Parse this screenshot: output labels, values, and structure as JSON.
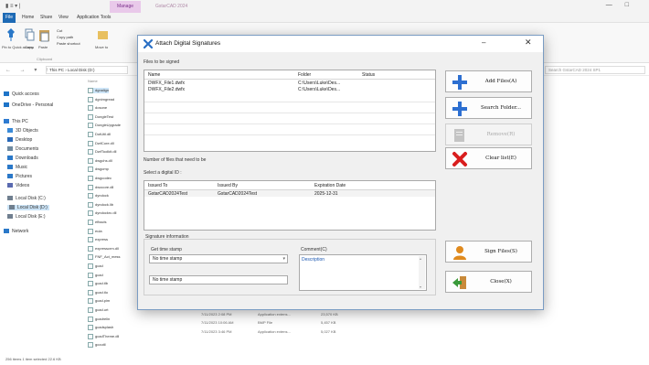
{
  "explorer": {
    "qat": "▮ ≡ ▾ |",
    "context_tab": "Manage",
    "window_title": "GstarCAD 2024",
    "ribbon_tabs": [
      "Home",
      "Share",
      "View",
      "Application Tools"
    ],
    "file_tab": "File",
    "ribbon": {
      "pin_label": "Pin to Quick access",
      "copy_label": "Copy",
      "paste_label": "Paste",
      "cut_label": "Cut",
      "copy_path_label": "Copy path",
      "paste_shortcut_label": "Paste shortcut",
      "move_label": "Move to",
      "clipboard_group": "Clipboard"
    },
    "address": {
      "nav": "← → ▾ ↑",
      "path": "This PC › Local Disk (D:)",
      "search": "Search GstarCAD 2024 SP1"
    },
    "nav_items": [
      {
        "label": "Quick access",
        "color": "#1e74c8"
      },
      {
        "label": "OneDrive - Personal",
        "color": "#1e74c8"
      },
      {
        "label": "This PC",
        "color": "#2e7bd1"
      },
      {
        "label": "3D Objects",
        "color": "#3a8ad8"
      },
      {
        "label": "Desktop",
        "color": "#2868b8"
      },
      {
        "label": "Documents",
        "color": "#6f8aa0"
      },
      {
        "label": "Downloads",
        "color": "#2a78c8"
      },
      {
        "label": "Music",
        "color": "#2a78c8"
      },
      {
        "label": "Pictures",
        "color": "#2a78c8"
      },
      {
        "label": "Videos",
        "color": "#5a6ab0"
      },
      {
        "label": "Local Disk (C:)",
        "color": "#707f8f"
      },
      {
        "label": "Local Disk (D:)",
        "color": "#707f8f",
        "selected": true
      },
      {
        "label": "Local Disk (E:)",
        "color": "#707f8f"
      },
      {
        "label": "Network",
        "color": "#2a78c8"
      }
    ],
    "files_header": "Name",
    "files": [
      "dgnalign",
      "dgnimgread",
      "dosone",
      "DongleTest",
      "DongleUpgrade",
      "DotUtil.dll",
      "DwfCore.dll",
      "DwfToolkit.dll",
      "dwgchs.dll",
      "dwgcmp",
      "dwgcodec",
      "dwocore.dll",
      "dyndock",
      "dyndock.lib",
      "dyndockrc.dll",
      "efissds",
      "eula",
      "express",
      "expresscrm.dll",
      "FNF_Act_mess",
      "gcad",
      "gcad",
      "gcad.tlb",
      "gcad.tlo",
      "gcad.pim",
      "gcad.urt",
      "gcadrelin",
      "gcadsplash",
      "gcadTheme.dll",
      "gcoutil"
    ],
    "file_meta": [
      {
        "date": "2/21/2023 8:52 AM",
        "type": "UWT File",
        "size": "11 KB"
      },
      {
        "date": "7/11/2023 2:08 PM",
        "type": "Application extens...",
        "size": "23,570 KB"
      },
      {
        "date": "7/11/2023 10:06 AM",
        "type": "BMP File",
        "size": "5,457 KB"
      },
      {
        "date": "7/11/2023 3:46 PM",
        "type": "Application extens...",
        "size": "5,027 KB"
      }
    ],
    "status": "256 items    1 item selected  22.6 KB"
  },
  "dialog": {
    "title": "Attach Digital Signatures",
    "files_label": "Files to be signed",
    "files_columns": [
      "Name",
      "Folder",
      "Status"
    ],
    "files_rows": [
      {
        "name": "DWFX_File1.dwfx",
        "folder": "C:\\Users\\Luke\\Des...",
        "status": ""
      },
      {
        "name": "DWFX_File2.dwfx",
        "folder": "C:\\Users\\Luke\\Des...",
        "status": ""
      }
    ],
    "count_label": "Number of files that need to be",
    "select_id_label": "Select a digital ID :",
    "id_columns": [
      "Issued To",
      "Issued By",
      "Expiration Date"
    ],
    "id_rows": [
      {
        "issued_to": "GstarCAD2024Test",
        "issued_by": "GstarCAD2024Test",
        "expiration": "2025-12-31"
      }
    ],
    "sig_info_label": "Signature information",
    "time_stamp_label": "Get time stamp",
    "time_stamp_value": "No time stamp",
    "time_stamp_list_item": "No time stamp",
    "comment_label": "Comment(C)",
    "comment_value": "Description",
    "buttons": {
      "add_files": "Add Files(A)",
      "search_folder": "Search Folder...",
      "remove": "Remove(R)",
      "clear_list": "Clear list(E)",
      "sign_files": "Sign Files(S)",
      "close": "Close(X)"
    },
    "colors": {
      "add_icon": "#2d6fd1",
      "clear_icon": "#d91e1e",
      "sign_icon": "#e08a1e",
      "close_icon": "#3a9a3a",
      "logo": "#2a6fc4"
    }
  }
}
